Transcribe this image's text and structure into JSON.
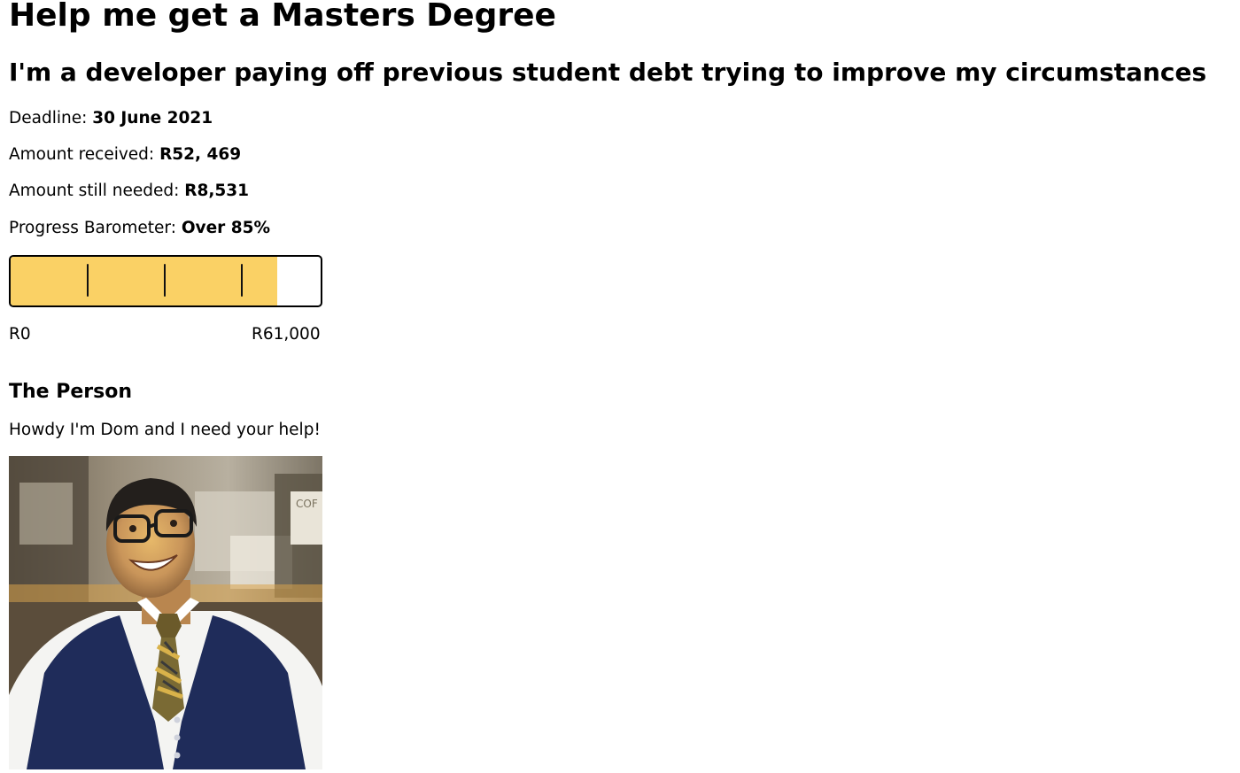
{
  "page": {
    "title": "Help me get a Masters Degree",
    "subtitle": "I'm a developer paying off previous student debt trying to improve my circumstances"
  },
  "stats": {
    "deadline_label": "Deadline:",
    "deadline_value": "30 June 2021",
    "received_label": "Amount received:",
    "received_value": "R52, 469",
    "needed_label": "Amount still needed:",
    "needed_value": "R8,531",
    "progress_label": "Progress Barometer:",
    "progress_value": "Over 85%"
  },
  "barometer": {
    "progress_fraction": 0.86,
    "fill_color": "#fad165",
    "min_label": "R0",
    "max_label": "R61,000"
  },
  "person": {
    "heading": "The Person",
    "intro": "Howdy I'm Dom and I need your help!",
    "photo_text": "COF"
  },
  "colors": {
    "vest": "#1f2c5a",
    "shirt": "#f4f4f2",
    "background_wall": "#8c8374"
  }
}
